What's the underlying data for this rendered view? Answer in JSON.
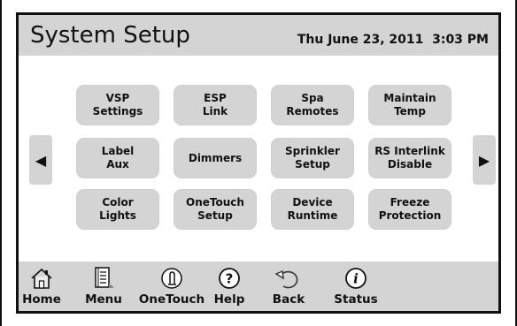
{
  "header": {
    "title": "System Setup",
    "datetime": "Thu June 23, 2011  3:03 PM"
  },
  "nav_arrows": {
    "left_icon": "triangle-left-icon",
    "right_icon": "triangle-right-icon"
  },
  "grid": [
    [
      "VSP\nSettings",
      "ESP\nLink",
      "Spa\nRemotes",
      "Maintain\nTemp"
    ],
    [
      "Label\nAux",
      "Dimmers",
      "Sprinkler\nSetup",
      "RS Interlink\nDisable"
    ],
    [
      "Color\nLights",
      "OneTouch\nSetup",
      "Device\nRuntime",
      "Freeze\nProtection"
    ]
  ],
  "footer": {
    "items": [
      {
        "label": "Home",
        "icon": "home-icon"
      },
      {
        "label": "Menu",
        "icon": "menu-icon"
      },
      {
        "label": "OneTouch",
        "icon": "onetouch-icon"
      },
      {
        "label": "Help",
        "icon": "help-icon"
      },
      {
        "label": "Back",
        "icon": "back-icon"
      },
      {
        "label": "Status",
        "icon": "info-icon"
      }
    ]
  },
  "colors": {
    "panel": "#d4d4d4",
    "border": "#111111",
    "background": "#ffffff"
  }
}
